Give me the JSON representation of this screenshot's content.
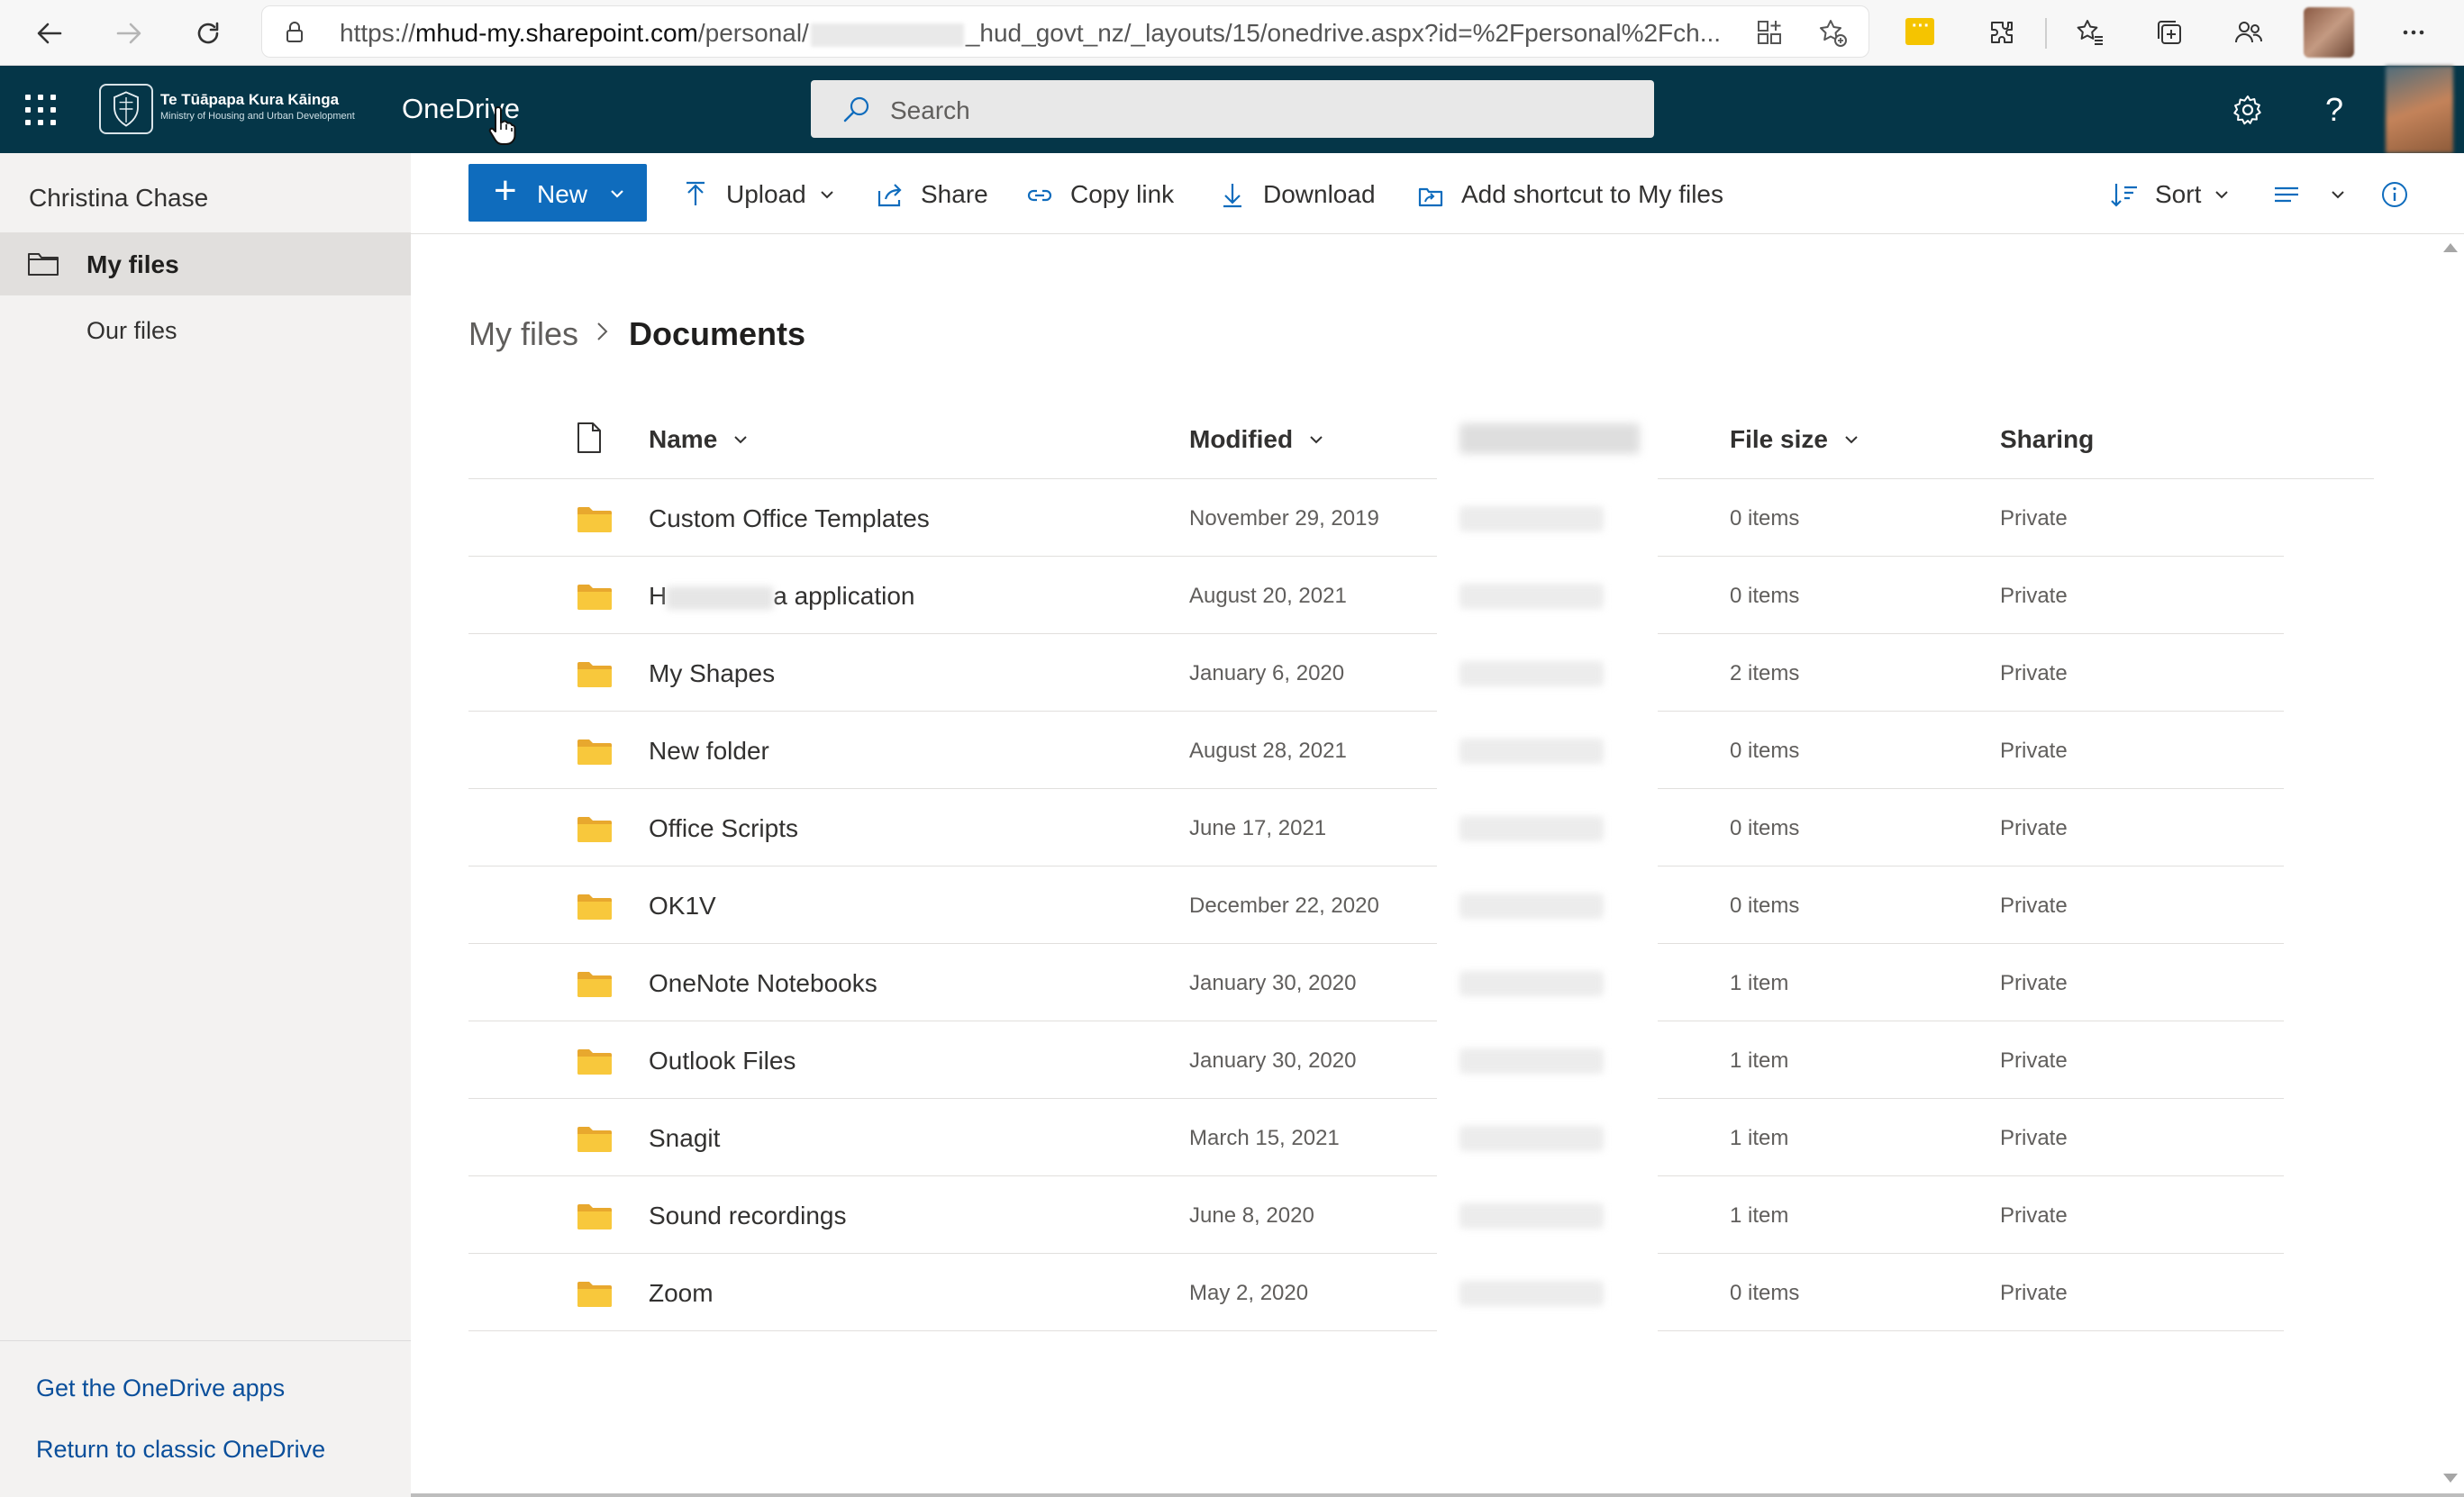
{
  "browser": {
    "url_prefix": "https://",
    "url_host": "mhud-my.sharepoint.com",
    "url_path_start": "/personal/",
    "url_path_end": "_hud_govt_nz/_layouts/15/onedrive.aspx?id=%2Fpersonal%2Fch..."
  },
  "suite": {
    "org_name": "Te Tūāpapa Kura Kāinga",
    "org_subtitle": "Ministry of Housing and Urban Development",
    "app_name": "OneDrive",
    "search_placeholder": "Search",
    "help_label": "?",
    "header_color": "#053648"
  },
  "leftnav": {
    "user_name": "Christina Chase",
    "items": [
      {
        "label": "My files",
        "icon": "folder-icon",
        "selected": true
      },
      {
        "label": "Our files",
        "selected": false
      }
    ],
    "footer_links": [
      "Get the OneDrive apps",
      "Return to classic OneDrive"
    ]
  },
  "commandbar": {
    "new_label": "New",
    "upload_label": "Upload",
    "share_label": "Share",
    "copy_link_label": "Copy link",
    "download_label": "Download",
    "add_shortcut_label": "Add shortcut to My files",
    "sort_label": "Sort",
    "accent_color": "#0f6cbd"
  },
  "breadcrumb": {
    "parent": "My files",
    "current": "Documents"
  },
  "list": {
    "columns": {
      "name": "Name",
      "modified": "Modified",
      "file_size": "File size",
      "sharing": "Sharing"
    },
    "rows": [
      {
        "name": "Custom Office Templates",
        "modified": "November 29, 2019",
        "size": "0 items",
        "sharing": "Private"
      },
      {
        "name_start": "H",
        "name_end": "a application",
        "modified": "August 20, 2021",
        "size": "0 items",
        "sharing": "Private"
      },
      {
        "name": "My Shapes",
        "modified": "January 6, 2020",
        "size": "2 items",
        "sharing": "Private"
      },
      {
        "name": "New folder",
        "modified": "August 28, 2021",
        "size": "0 items",
        "sharing": "Private"
      },
      {
        "name": "Office Scripts",
        "modified": "June 17, 2021",
        "size": "0 items",
        "sharing": "Private"
      },
      {
        "name": "OK1V",
        "modified": "December 22, 2020",
        "size": "0 items",
        "sharing": "Private"
      },
      {
        "name": "OneNote Notebooks",
        "modified": "January 30, 2020",
        "size": "1 item",
        "sharing": "Private"
      },
      {
        "name": "Outlook Files",
        "modified": "January 30, 2020",
        "size": "1 item",
        "sharing": "Private"
      },
      {
        "name": "Snagit",
        "modified": "March 15, 2021",
        "size": "1 item",
        "sharing": "Private"
      },
      {
        "name": "Sound recordings",
        "modified": "June 8, 2020",
        "size": "1 item",
        "sharing": "Private"
      },
      {
        "name": "Zoom",
        "modified": "May 2, 2020",
        "size": "0 items",
        "sharing": "Private"
      }
    ],
    "folder_color": "#f8c83c"
  }
}
